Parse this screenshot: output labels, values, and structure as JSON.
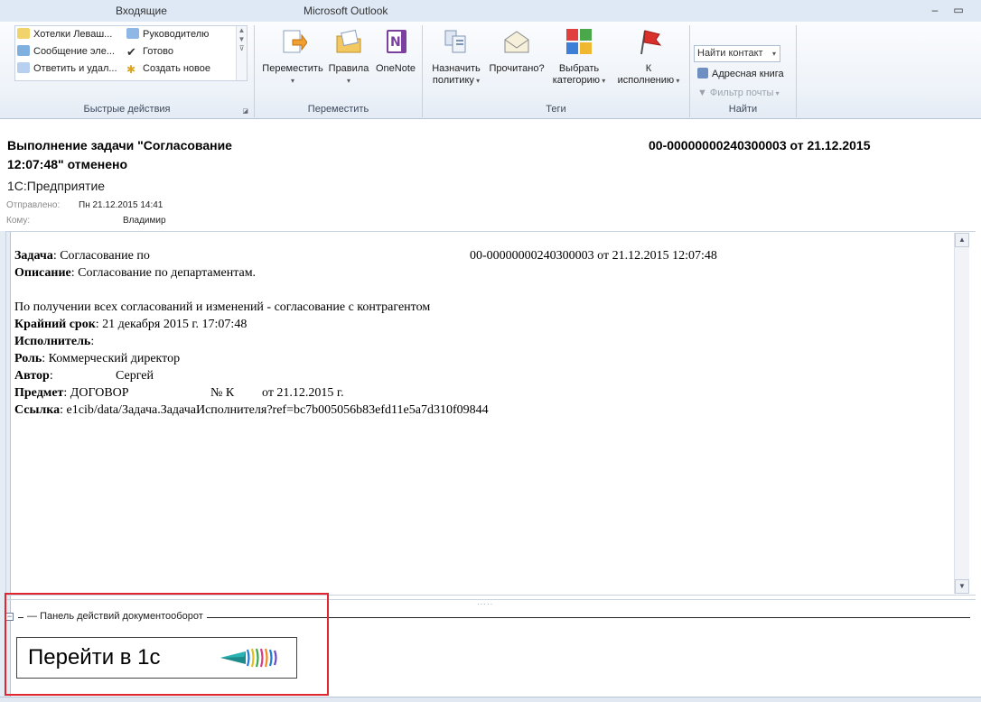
{
  "window": {
    "folder": "Входящие",
    "app_name": "Microsoft Outlook",
    "minimize_glyph": "–",
    "maximize_glyph": "▭"
  },
  "ribbon": {
    "quick_steps": {
      "items": [
        "Хотелки Леваш...",
        "Сообщение эле...",
        "Ответить и удал...",
        "Руководителю",
        "Готово",
        "Создать новое"
      ],
      "label": "Быстрые действия"
    },
    "move_group": {
      "buttons": [
        "Переместить",
        "Правила",
        "OneNote"
      ],
      "label": "Переместить"
    },
    "tags_group": {
      "assign_policy": [
        "Назначить",
        "политику"
      ],
      "read": [
        "Прочитано?"
      ],
      "categorize": [
        "Выбрать",
        "категорию"
      ],
      "followup": [
        "К",
        "исполнению"
      ],
      "label": "Теги"
    },
    "find_group": {
      "find_contact": "Найти контакт",
      "address_book": "Адресная книга",
      "filter_mail": "Фильтр почты",
      "label": "Найти"
    }
  },
  "message": {
    "subject_line1": "Выполнение задачи \"Согласование",
    "subject_line2": "12:07:48\" отменено",
    "subject_right": "00-00000000240300003 от 21.12.2015",
    "sender": "1С:Предприятие",
    "sent_label": "Отправлено:",
    "sent_value": "Пн 21.12.2015 14:41",
    "to_label": "Кому:",
    "to_value": "Владимир"
  },
  "body": {
    "task_label": "Задача",
    "task_value": ": Согласование по",
    "task_number": "00-00000000240300003 от 21.12.2015 12:07:48",
    "desc_label": "Описание",
    "desc_value": ": Согласование по департаментам.",
    "note": "По получении всех согласований и изменений - согласование с контрагентом",
    "deadline_label": "Крайний срок",
    "deadline_value": ": 21 декабря 2015 г. 17:07:48",
    "performer_label": "Исполнитель",
    "performer_value": ":",
    "role_label": "Роль",
    "role_value": ": Коммерческий директор",
    "author_label": "Автор",
    "author_value": ":",
    "author_name": "Сергей",
    "subject_label": "Предмет",
    "subject_value": ": ДОГОВОР",
    "subject_no": "№ К",
    "subject_date": "от 21.12.2015 г.",
    "link_label": "Ссылка",
    "link_value": ": e1cib/data/Задача.ЗадачаИсполнителя?ref=bc7b005056b83efd11e5a7d310f09844"
  },
  "action_panel": {
    "title": "Панель действий документооборот",
    "goto_button": "Перейти в 1с"
  },
  "colors": {
    "highlight": "#e0262e",
    "ribbon_bg": "#eef3f9"
  }
}
